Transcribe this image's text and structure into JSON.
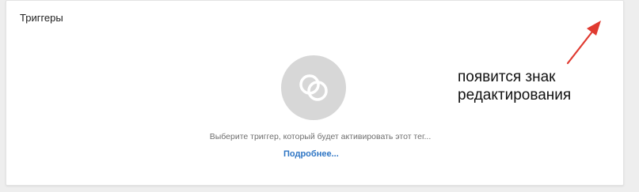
{
  "card": {
    "title": "Триггеры",
    "hint": "Выберите триггер, который будет активировать этот тег...",
    "learn_more": "Подробнее..."
  },
  "annotation": {
    "line1": "появится знак",
    "line2": "редактирования"
  },
  "icons": {
    "trigger": "trigger-rings-icon",
    "arrow": "red-arrow-icon"
  },
  "colors": {
    "link": "#2e75c4",
    "arrow": "#e03a30",
    "circle": "#d7d7d7"
  }
}
